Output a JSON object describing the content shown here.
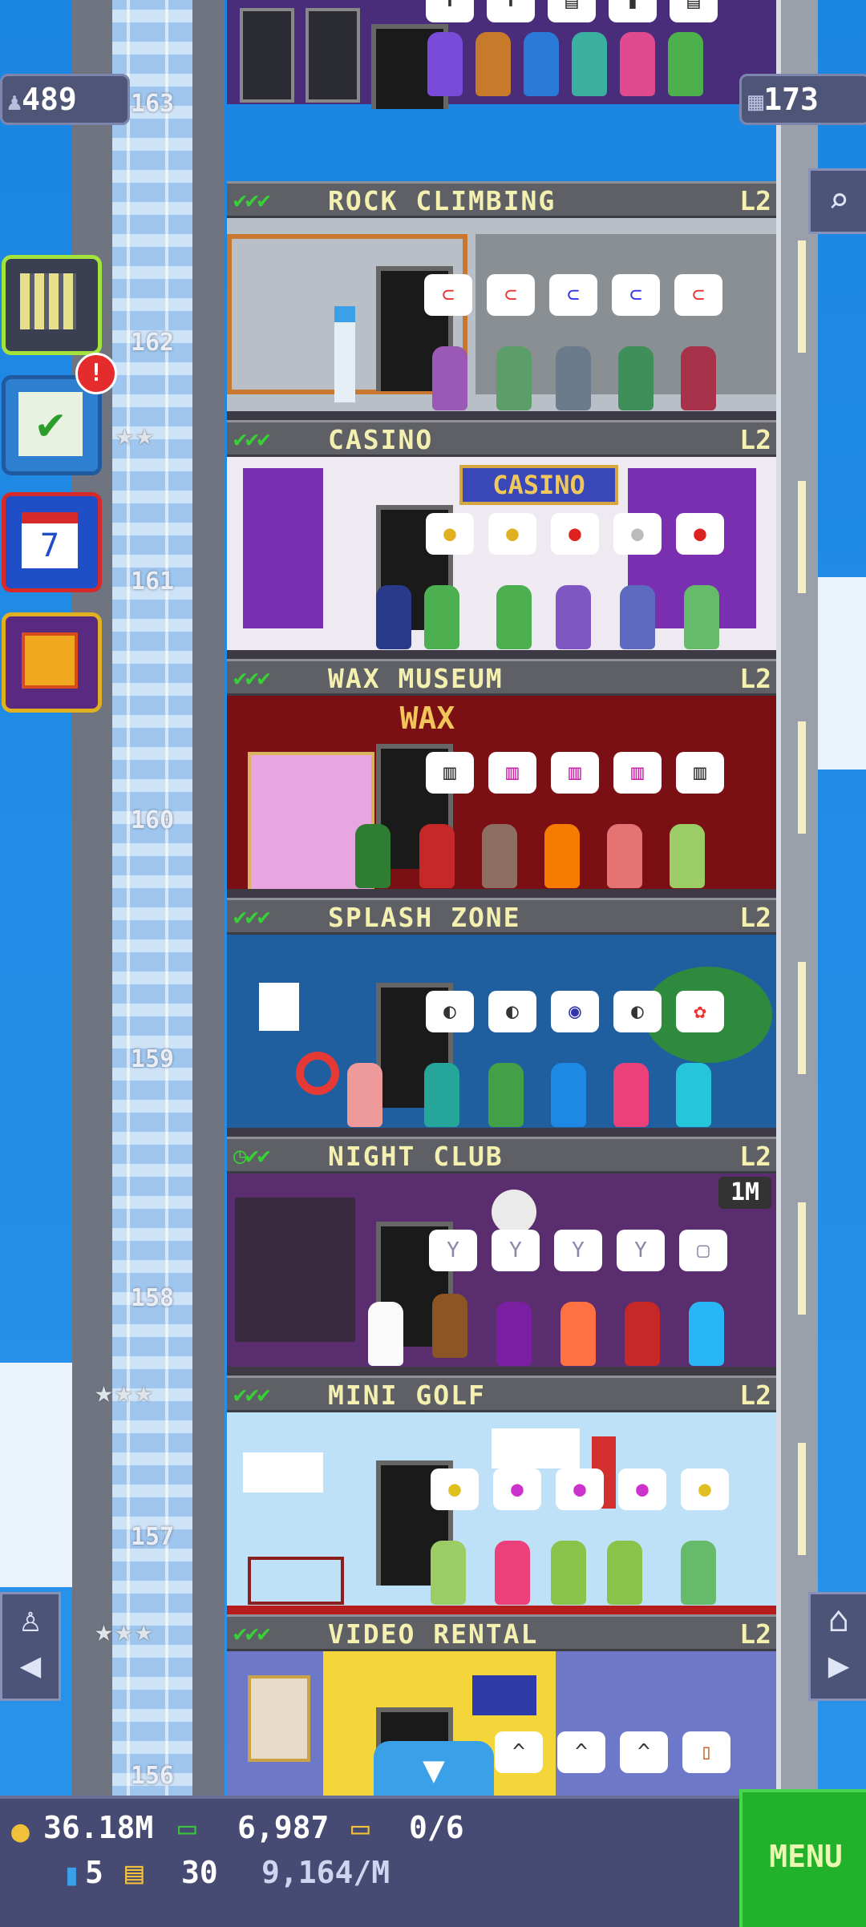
{
  "top": {
    "population": "489",
    "floors": "173"
  },
  "left_menu": {
    "badge": "!"
  },
  "shaft_numbers": [
    "163",
    "162",
    "161",
    "160",
    "159",
    "158",
    "157",
    "156"
  ],
  "floors": [
    {
      "checks": "✔✔✔",
      "name": "ROCK CLIMBING",
      "level": "L2"
    },
    {
      "checks": "✔✔✔",
      "name": "CASINO",
      "level": "L2"
    },
    {
      "checks": "✔✔✔",
      "name": "WAX MUSEUM",
      "level": "L2"
    },
    {
      "checks": "✔✔✔",
      "name": "SPLASH ZONE",
      "level": "L2"
    },
    {
      "checks": "◷✔✔",
      "name": "NIGHT CLUB",
      "level": "L2"
    },
    {
      "checks": "✔✔✔",
      "name": "MINI GOLF",
      "level": "L2"
    },
    {
      "checks": "✔✔✔",
      "name": "VIDEO RENTAL",
      "level": "L2"
    }
  ],
  "signs": {
    "casino": "CASINO",
    "wax": "WAX",
    "nightclub_badge": "1M"
  },
  "hud": {
    "coins": "36.18M",
    "bux": "6,987",
    "tickets": "0/6",
    "keys": "5",
    "vip": "30",
    "rate": "9,164/M",
    "menu": "MENU"
  },
  "colors": {
    "check": "#37d137",
    "label": "#f4f0b0",
    "menu_bg": "#22b12a"
  }
}
